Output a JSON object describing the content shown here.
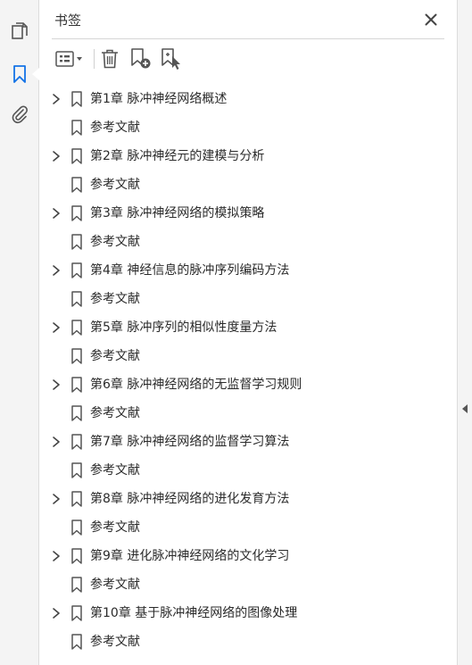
{
  "panel": {
    "title": "书签"
  },
  "icons": {
    "rail": [
      "pages-icon",
      "bookmark-icon",
      "attachment-icon"
    ],
    "toolbar": [
      "options-menu-icon",
      "delete-icon",
      "new-bookmark-icon",
      "bookmark-from-selection-icon"
    ],
    "close": "close-icon",
    "expand": "chevron-right-icon",
    "bookmark": "bookmark-icon"
  },
  "colors": {
    "accent": "#1473e6",
    "icon": "#555555",
    "text": "#2b2b2b"
  },
  "bookmarks": [
    {
      "label": "第1章 脉冲神经网络概述",
      "expandable": true
    },
    {
      "label": "参考文献",
      "expandable": false
    },
    {
      "label": "第2章 脉冲神经元的建模与分析",
      "expandable": true
    },
    {
      "label": "参考文献",
      "expandable": false
    },
    {
      "label": "第3章 脉冲神经网络的模拟策略",
      "expandable": true
    },
    {
      "label": "参考文献",
      "expandable": false
    },
    {
      "label": "第4章 神经信息的脉冲序列编码方法",
      "expandable": true
    },
    {
      "label": "参考文献",
      "expandable": false
    },
    {
      "label": "第5章 脉冲序列的相似性度量方法",
      "expandable": true
    },
    {
      "label": "参考文献",
      "expandable": false
    },
    {
      "label": "第6章 脉冲神经网络的无监督学习规则",
      "expandable": true
    },
    {
      "label": "参考文献",
      "expandable": false
    },
    {
      "label": "第7章 脉冲神经网络的监督学习算法",
      "expandable": true
    },
    {
      "label": "参考文献",
      "expandable": false
    },
    {
      "label": "第8章 脉冲神经网络的进化发育方法",
      "expandable": true
    },
    {
      "label": "参考文献",
      "expandable": false
    },
    {
      "label": "第9章 进化脉冲神经网络的文化学习",
      "expandable": true
    },
    {
      "label": "参考文献",
      "expandable": false
    },
    {
      "label": "第10章 基于脉冲神经网络的图像处理",
      "expandable": true
    },
    {
      "label": "参考文献",
      "expandable": false
    }
  ]
}
